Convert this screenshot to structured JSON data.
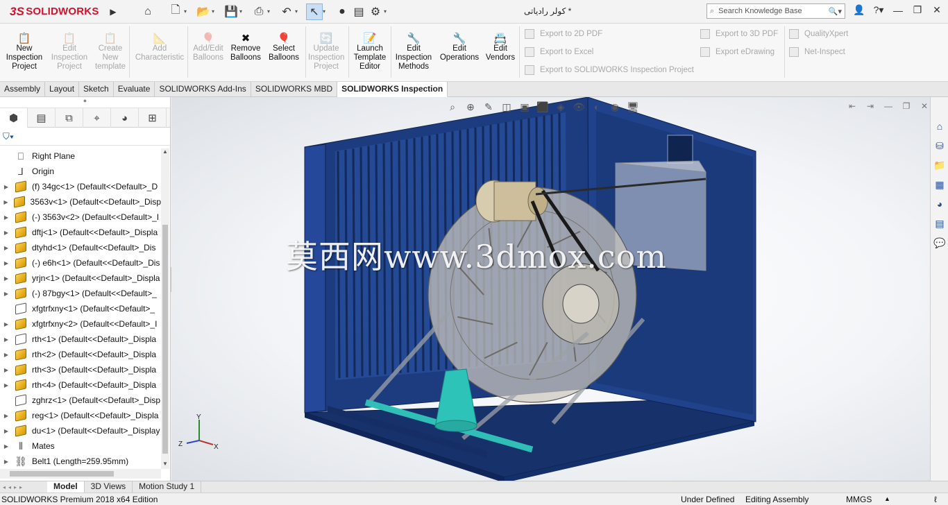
{
  "titlebar": {
    "brand": "SOLIDWORKS",
    "brand_mark": "3S",
    "document_title": "کولر رادیاتی *",
    "search_placeholder": "Search Knowledge Base"
  },
  "ribbon": {
    "buttons": [
      {
        "lines": [
          "New",
          "Inspection",
          "Project"
        ],
        "enabled": true
      },
      {
        "lines": [
          "Edit",
          "Inspection",
          "Project"
        ],
        "enabled": false
      },
      {
        "lines": [
          "Create",
          "New",
          "template"
        ],
        "enabled": false
      },
      {
        "lines": [
          "Add",
          "Characteristic"
        ],
        "enabled": false
      },
      {
        "lines": [
          "Add/Edit",
          "Balloons"
        ],
        "enabled": false
      },
      {
        "lines": [
          "Remove",
          "Balloons"
        ],
        "enabled": true
      },
      {
        "lines": [
          "Select",
          "Balloons"
        ],
        "enabled": true
      },
      {
        "lines": [
          "Update",
          "Inspection",
          "Project"
        ],
        "enabled": false
      },
      {
        "lines": [
          "Launch",
          "Template",
          "Editor"
        ],
        "enabled": true
      },
      {
        "lines": [
          "Edit",
          "Inspection",
          "Methods"
        ],
        "enabled": true
      },
      {
        "lines": [
          "Edit",
          "Operations"
        ],
        "enabled": true
      },
      {
        "lines": [
          "Edit",
          "Vendors"
        ],
        "enabled": true
      }
    ],
    "small": {
      "export_2d_pdf": "Export to 2D PDF",
      "export_excel": "Export to Excel",
      "export_inspection_project": "Export to SOLIDWORKS Inspection Project",
      "export_3d_pdf": "Export to 3D PDF",
      "export_edrawing": "Export eDrawing",
      "qualityxpert": "QualityXpert",
      "net_inspect": "Net-Inspect"
    }
  },
  "tabs": [
    "Assembly",
    "Layout",
    "Sketch",
    "Evaluate",
    "SOLIDWORKS Add-Ins",
    "SOLIDWORKS MBD",
    "SOLIDWORKS Inspection"
  ],
  "active_tab": "SOLIDWORKS Inspection",
  "tree": [
    {
      "label": "Right Plane",
      "icon": "plane-icon",
      "expandable": false
    },
    {
      "label": "Origin",
      "icon": "origin-icon",
      "expandable": false
    },
    {
      "label": "(f) 34gc<1> (Default<<Default>_D",
      "icon": "part-icon",
      "expandable": true
    },
    {
      "label": "3563v<1> (Default<<Default>_Disp",
      "icon": "part-icon",
      "expandable": true
    },
    {
      "label": "(-) 3563v<2> (Default<<Default>_I",
      "icon": "part-icon",
      "expandable": true
    },
    {
      "label": "dftj<1> (Default<<Default>_Displa",
      "icon": "part-icon",
      "expandable": true
    },
    {
      "label": "dtyhd<1> (Default<<Default>_Dis",
      "icon": "part-icon",
      "expandable": true
    },
    {
      "label": "(-) e6h<1> (Default<<Default>_Dis",
      "icon": "part-icon",
      "expandable": true
    },
    {
      "label": "yrjn<1> (Default<<Default>_Displa",
      "icon": "part-icon",
      "expandable": true
    },
    {
      "label": "(-) 87bgy<1> (Default<<Default>_",
      "icon": "part-icon",
      "expandable": true
    },
    {
      "label": "xfgtrfxny<1> (Default<<Default>_",
      "icon": "part-wire-icon",
      "expandable": false
    },
    {
      "label": "xfgtrfxny<2> (Default<<Default>_I",
      "icon": "part-icon",
      "expandable": true
    },
    {
      "label": "rth<1> (Default<<Default>_Displa",
      "icon": "part-wire-icon",
      "expandable": true
    },
    {
      "label": "rth<2> (Default<<Default>_Displa",
      "icon": "part-icon",
      "expandable": true
    },
    {
      "label": "rth<3> (Default<<Default>_Displa",
      "icon": "part-icon",
      "expandable": true
    },
    {
      "label": "rth<4> (Default<<Default>_Displa",
      "icon": "part-icon",
      "expandable": true
    },
    {
      "label": "zghrz<1> (Default<<Default>_Disp",
      "icon": "part-wire-icon",
      "expandable": false
    },
    {
      "label": "reg<1> (Default<<Default>_Displa",
      "icon": "part-icon",
      "expandable": true
    },
    {
      "label": "du<1> (Default<<Default>_Display",
      "icon": "part-icon",
      "expandable": true
    },
    {
      "label": "Mates",
      "icon": "mates-icon",
      "expandable": true
    },
    {
      "label": "Belt1 (Length=259.95mm)",
      "icon": "belt-icon",
      "expandable": true
    }
  ],
  "viewport": {
    "watermark": "莫西网www.3dmox.com",
    "triad": {
      "y": "Y",
      "z": "Z",
      "x": "X"
    },
    "colors": {
      "housing": "#1f3f86",
      "cone": "#2fbfb6",
      "bg": "#eef1f5"
    }
  },
  "bottom_tabs": [
    "Model",
    "3D Views",
    "Motion Study 1"
  ],
  "active_bottom_tab": "Model",
  "status": {
    "product": "SOLIDWORKS Premium 2018 x64 Edition",
    "state": "Under Defined",
    "mode": "Editing Assembly",
    "units": "MMGS"
  }
}
